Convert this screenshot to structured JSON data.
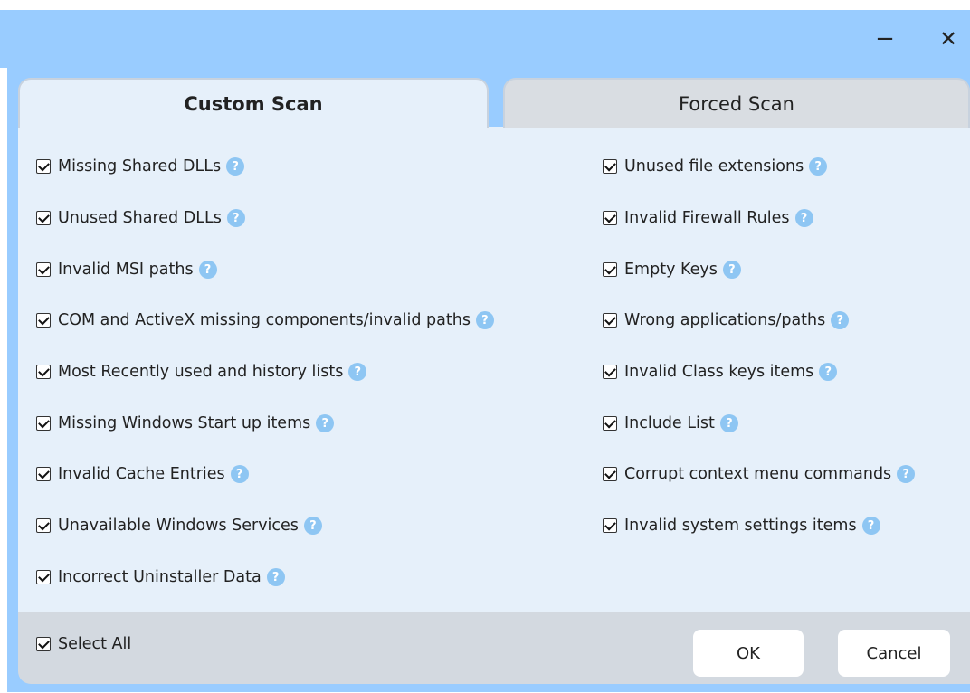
{
  "window": {
    "minimize_glyph": "−",
    "close_glyph": "✕"
  },
  "tabs": [
    {
      "label": "Custom Scan",
      "active": true
    },
    {
      "label": "Forced Scan",
      "active": false
    }
  ],
  "help_glyph": "?",
  "left_items": [
    {
      "label": "Missing Shared DLLs",
      "checked": true
    },
    {
      "label": "Unused Shared DLLs",
      "checked": true
    },
    {
      "label": "Invalid MSI paths",
      "checked": true
    },
    {
      "label": "COM and ActiveX missing components/invalid paths",
      "checked": true
    },
    {
      "label": "Most Recently used and history lists",
      "checked": true
    },
    {
      "label": "Missing Windows Start up items",
      "checked": true
    },
    {
      "label": "Invalid Cache Entries",
      "checked": true
    },
    {
      "label": "Unavailable Windows Services",
      "checked": true
    },
    {
      "label": "Incorrect Uninstaller Data",
      "checked": true
    }
  ],
  "right_items": [
    {
      "label": "Unused file extensions",
      "checked": true
    },
    {
      "label": "Invalid Firewall Rules",
      "checked": true
    },
    {
      "label": "Empty Keys",
      "checked": true
    },
    {
      "label": "Wrong applications/paths",
      "checked": true
    },
    {
      "label": "Invalid Class keys items",
      "checked": true
    },
    {
      "label": "Include List",
      "checked": true
    },
    {
      "label": "Corrupt context menu commands",
      "checked": true
    },
    {
      "label": "Invalid system settings items",
      "checked": true
    }
  ],
  "footer": {
    "select_all": {
      "label": "Select All",
      "checked": true
    },
    "ok_label": "OK",
    "cancel_label": "Cancel"
  },
  "colors": {
    "titlebar": "#99ccff",
    "panel": "#e6f0fa",
    "footer": "#d3d9e0",
    "help_icon": "#8ec6f3"
  }
}
